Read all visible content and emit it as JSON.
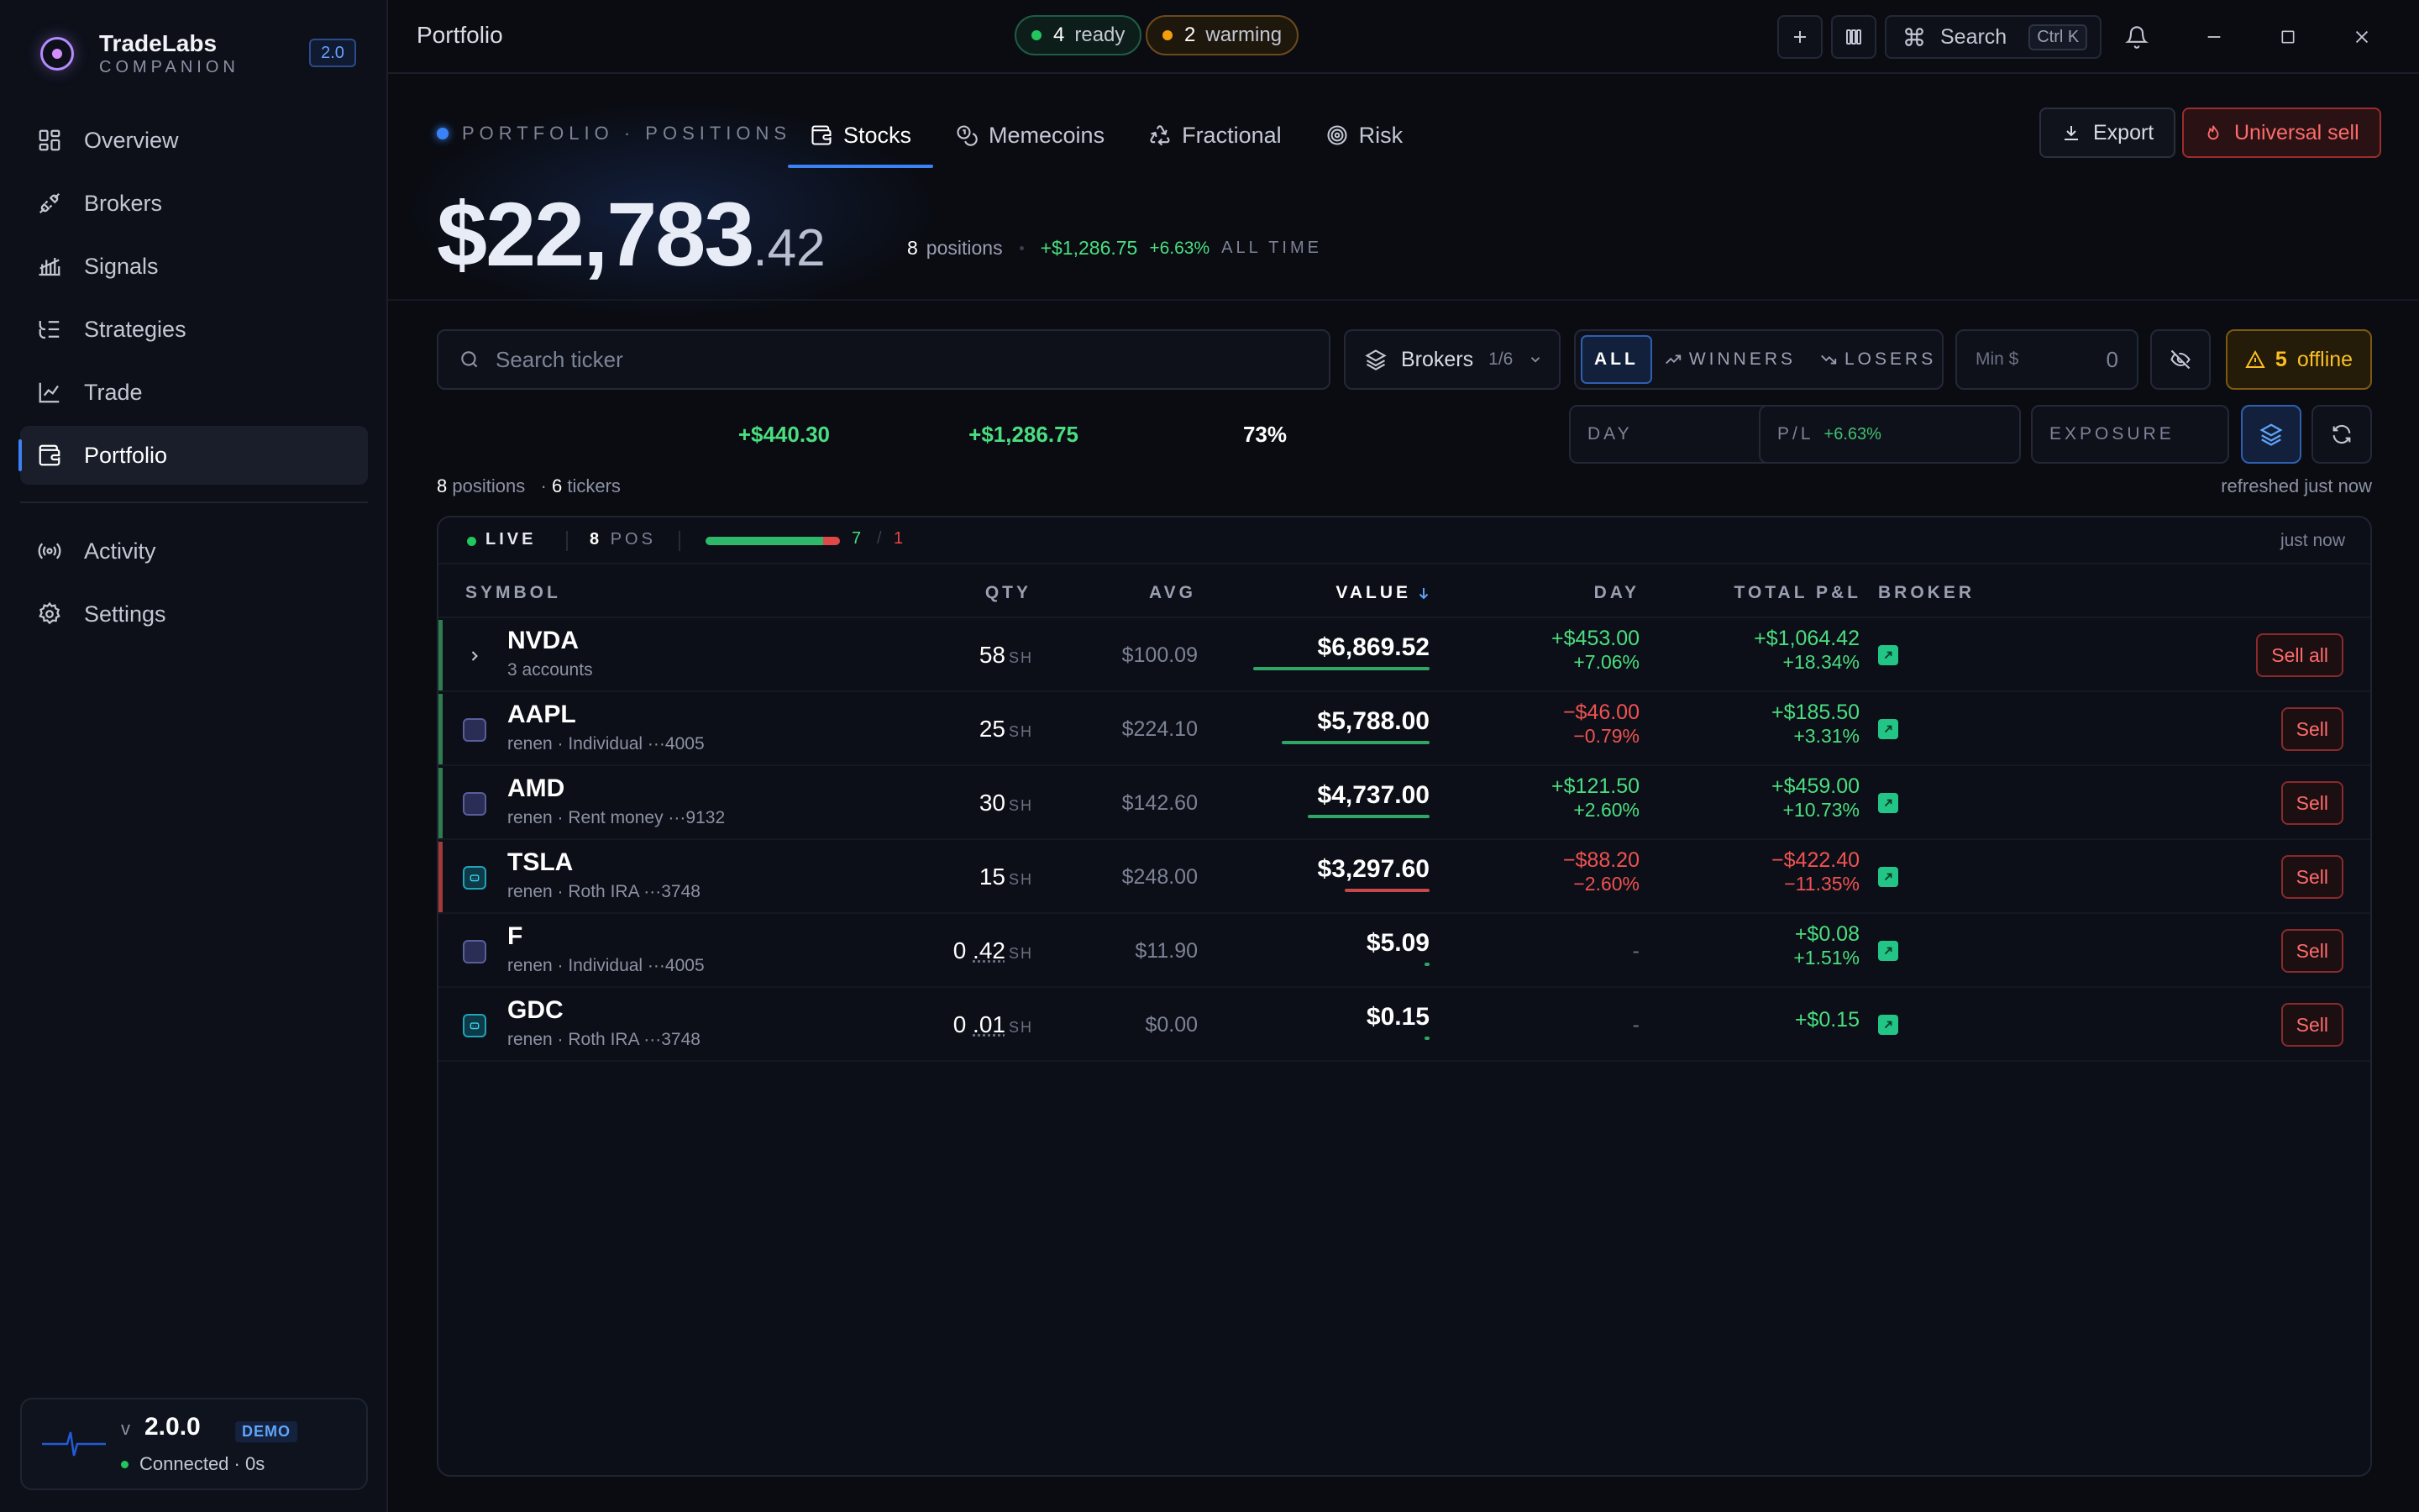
{
  "sidebar": {
    "brand_name": "TradeLabs",
    "brand_sub": "COMPANION",
    "version_badge": "2.0",
    "nav": [
      {
        "label": "Overview",
        "icon": "grid-icon"
      },
      {
        "label": "Brokers",
        "icon": "plug-icon"
      },
      {
        "label": "Signals",
        "icon": "signal-icon"
      },
      {
        "label": "Strategies",
        "icon": "list-tree-icon"
      },
      {
        "label": "Trade",
        "icon": "chart-line-icon"
      },
      {
        "label": "Portfolio",
        "icon": "wallet-icon",
        "active": true
      }
    ],
    "nav2": [
      {
        "label": "Activity",
        "icon": "broadcast-icon"
      },
      {
        "label": "Settings",
        "icon": "gear-icon"
      }
    ],
    "version": {
      "prefix": "v",
      "number": "2.0.0",
      "tag": "DEMO",
      "status": "Connected · 0s"
    }
  },
  "topbar": {
    "title": "Portfolio",
    "ready_count": "4",
    "ready_label": "ready",
    "warming_count": "2",
    "warming_label": "warming",
    "search_label": "Search",
    "search_shortcut": "Ctrl K"
  },
  "header": {
    "section_label": "PORTFOLIO · POSITIONS",
    "tabs": [
      {
        "label": "Stocks",
        "icon": "wallet-icon",
        "active": true
      },
      {
        "label": "Memecoins",
        "icon": "coins-icon"
      },
      {
        "label": "Fractional",
        "icon": "recycle-icon"
      },
      {
        "label": "Risk",
        "icon": "target-icon"
      }
    ],
    "export_label": "Export",
    "universal_sell_label": "Universal sell",
    "total_main": "$22,783",
    "total_cents": ".42",
    "positions_count": "8",
    "positions_label": "positions",
    "all_time_gain": "+$1,286.75",
    "all_time_pct": "+6.63%",
    "all_time_label": "ALL TIME"
  },
  "filters": {
    "search_placeholder": "Search ticker",
    "brokers_label": "Brokers",
    "brokers_count": "1/6",
    "segments": [
      {
        "label": "ALL",
        "active": true
      },
      {
        "label": "WINNERS",
        "icon": "trend-up-icon"
      },
      {
        "label": "LOSERS",
        "icon": "trend-down-icon"
      }
    ],
    "min_label": "Min $",
    "min_value": "0",
    "offline_count": "5",
    "offline_label": "offline"
  },
  "stats": {
    "day_label": "DAY",
    "day_value": "+$440.30",
    "pl_label": "P/L",
    "pl_value": "+$1,286.75",
    "pl_pct": "+6.63%",
    "exposure_label": "EXPOSURE",
    "exposure_value": "73%"
  },
  "counts": {
    "positions": "8",
    "positions_label": "positions",
    "tickers": "6",
    "tickers_label": "tickers",
    "refreshed": "refreshed just now"
  },
  "table": {
    "live_label": "LIVE",
    "pos_count": "8",
    "pos_label": "POS",
    "winners": 7,
    "losers": 1,
    "winners_text": "7",
    "ratio_sep": "/",
    "losers_text": "1",
    "updated": "just now",
    "columns": [
      "SYMBOL",
      "QTY",
      "AVG",
      "VALUE",
      "DAY",
      "TOTAL P&L",
      "BROKER"
    ],
    "sort_column": "VALUE",
    "rows": [
      {
        "symbol": "NVDA",
        "account": "3 accounts",
        "lead": "expand",
        "qty_int": "58",
        "qty_frac": "",
        "unit": "SH",
        "avg": "$100.09",
        "value": "$6,869.52",
        "value_share": 1.0,
        "day": "+$453.00",
        "day_pct": "+7.06%",
        "pnl": "+$1,064.42",
        "pnl_pct": "+18.34%",
        "sell": "Sell all",
        "trend": "up"
      },
      {
        "symbol": "AAPL",
        "account": "renen · Individual ···4005",
        "lead": "check",
        "qty_int": "25",
        "qty_frac": "",
        "unit": "SH",
        "avg": "$224.10",
        "value": "$5,788.00",
        "value_share": 0.84,
        "day": "−$46.00",
        "day_pct": "−0.79%",
        "pnl": "+$185.50",
        "pnl_pct": "+3.31%",
        "sell": "Sell",
        "trend": "up"
      },
      {
        "symbol": "AMD",
        "account": "renen · Rent money ···9132",
        "lead": "check",
        "qty_int": "30",
        "qty_frac": "",
        "unit": "SH",
        "avg": "$142.60",
        "value": "$4,737.00",
        "value_share": 0.69,
        "day": "+$121.50",
        "day_pct": "+2.60%",
        "pnl": "+$459.00",
        "pnl_pct": "+10.73%",
        "sell": "Sell",
        "trend": "up"
      },
      {
        "symbol": "TSLA",
        "account": "renen · Roth IRA ···3748",
        "lead": "teal",
        "qty_int": "15",
        "qty_frac": "",
        "unit": "SH",
        "avg": "$248.00",
        "value": "$3,297.60",
        "value_share": 0.48,
        "day": "−$88.20",
        "day_pct": "−2.60%",
        "pnl": "−$422.40",
        "pnl_pct": "−11.35%",
        "sell": "Sell",
        "trend": "down"
      },
      {
        "symbol": "F",
        "account": "renen · Individual ···4005",
        "lead": "check",
        "qty_int": "0",
        "qty_frac": ".42",
        "unit": "SH",
        "avg": "$11.90",
        "value": "$5.09",
        "value_share": 0.01,
        "day": "-",
        "day_pct": "",
        "pnl": "+$0.08",
        "pnl_pct": "+1.51%",
        "sell": "Sell",
        "trend": "flat"
      },
      {
        "symbol": "GDC",
        "account": "renen · Roth IRA ···3748",
        "lead": "teal",
        "qty_int": "0",
        "qty_frac": ".01",
        "unit": "SH",
        "avg": "$0.00",
        "value": "$0.15",
        "value_share": 0.005,
        "day": "-",
        "day_pct": "",
        "pnl": "+$0.15",
        "pnl_pct": "",
        "sell": "Sell",
        "trend": "flat"
      }
    ]
  },
  "colors": {
    "accent": "#3b82f6",
    "gain": "#4ade80",
    "loss": "#f05252",
    "warn": "#fbbf24",
    "brand": "#b48cff",
    "broker": "#22c585"
  }
}
